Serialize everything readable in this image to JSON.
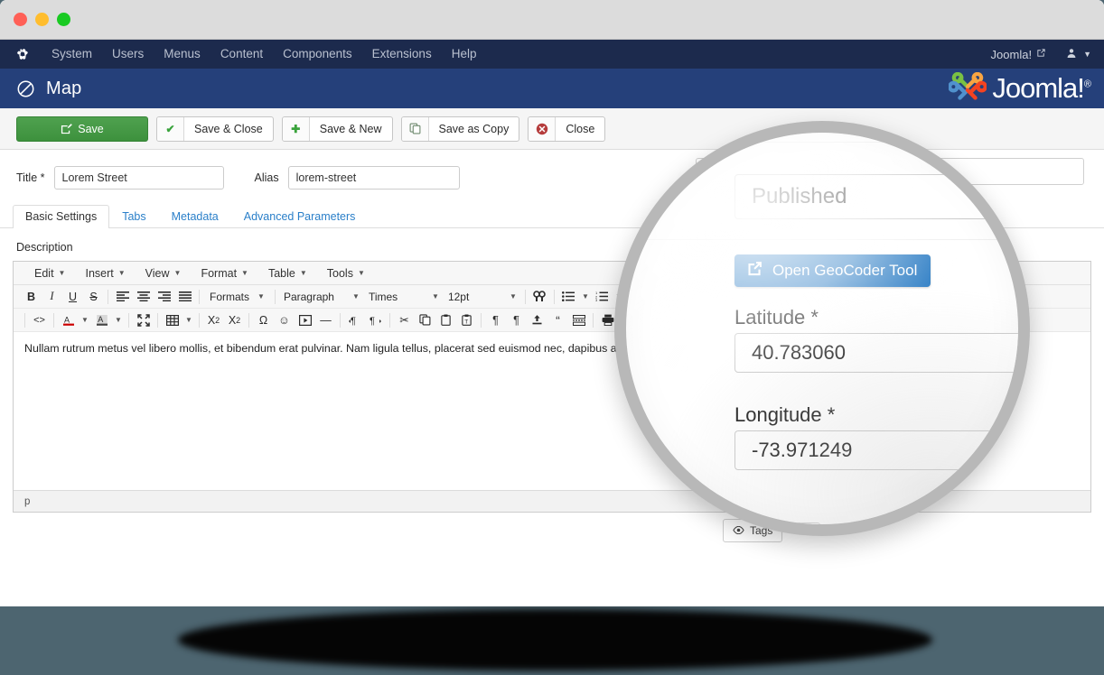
{
  "window": {
    "traffic_lights": [
      "close",
      "minimize",
      "maximize"
    ]
  },
  "admin_menu": {
    "brand_icon": "joomla-brand-icon",
    "items": [
      "System",
      "Users",
      "Menus",
      "Content",
      "Components",
      "Extensions",
      "Help"
    ],
    "site_link": "Joomla!",
    "external_link_icon": "external-link-icon",
    "user_icon": "user-icon",
    "caret_icon": "chevron-down-icon"
  },
  "subhead": {
    "page_icon": "map-marker-slash-icon",
    "title": "Map",
    "logo_text": "Joomla!",
    "logo_sup": "®"
  },
  "toolbar": {
    "buttons": [
      {
        "label": "Save",
        "icon": "pencil-square-icon",
        "style": "primary"
      },
      {
        "label": "Save & Close",
        "icon": "check-icon",
        "style": "default"
      },
      {
        "label": "Save & New",
        "icon": "plus-icon",
        "style": "default"
      },
      {
        "label": "Save as Copy",
        "icon": "copy-icon",
        "style": "default"
      },
      {
        "label": "Close",
        "icon": "cancel-circle-icon",
        "style": "default"
      }
    ]
  },
  "form": {
    "title_label": "Title *",
    "title_value": "Lorem Street",
    "alias_label": "Alias",
    "alias_value": "lorem-street",
    "tabs": [
      {
        "label": "Basic Settings",
        "active": true
      },
      {
        "label": "Tabs",
        "active": false
      },
      {
        "label": "Metadata",
        "active": false
      },
      {
        "label": "Advanced Parameters",
        "active": false
      }
    ],
    "description_label": "Description"
  },
  "editor": {
    "menubar": [
      "Edit",
      "Insert",
      "View",
      "Format",
      "Table",
      "Tools"
    ],
    "toolbar_row1": [
      {
        "name": "bold",
        "glyph": "B"
      },
      {
        "name": "italic",
        "glyph": "I"
      },
      {
        "name": "underline",
        "glyph": "U"
      },
      {
        "name": "strikethrough",
        "glyph": "S"
      },
      {
        "name": "align-left",
        "glyph": "☰"
      },
      {
        "name": "align-center",
        "glyph": "☰"
      },
      {
        "name": "align-right",
        "glyph": "☰"
      },
      {
        "name": "align-justify",
        "glyph": "☰"
      }
    ],
    "formats_label": "Formats",
    "paragraph_label": "Paragraph",
    "font_label": "Times",
    "fontsize_label": "12pt",
    "toolbar_row1_tail": [
      {
        "name": "search-replace",
        "glyph": "🔍"
      },
      {
        "name": "bullet-list",
        "glyph": "☰"
      },
      {
        "name": "numbered-list",
        "glyph": "☰"
      },
      {
        "name": "outdent",
        "glyph": "☰"
      }
    ],
    "toolbar_row2": [
      {
        "name": "source-code",
        "glyph": "<>"
      },
      {
        "name": "text-color",
        "glyph": "A"
      },
      {
        "name": "background-color",
        "glyph": "A"
      },
      {
        "name": "fullscreen",
        "glyph": "⛶"
      },
      {
        "name": "table",
        "glyph": "▦"
      },
      {
        "name": "subscript",
        "glyph": "X"
      },
      {
        "name": "superscript",
        "glyph": "X"
      },
      {
        "name": "special-character",
        "glyph": "Ω"
      },
      {
        "name": "emoticon",
        "glyph": "☺"
      },
      {
        "name": "media",
        "glyph": "▣"
      },
      {
        "name": "horizontal-rule",
        "glyph": "—"
      },
      {
        "name": "ltr",
        "glyph": "¶"
      },
      {
        "name": "rtl",
        "glyph": "¶"
      },
      {
        "name": "cut",
        "glyph": "✂"
      },
      {
        "name": "copy",
        "glyph": "❐"
      },
      {
        "name": "paste",
        "glyph": "Ὄb"
      },
      {
        "name": "paste-as-text",
        "glyph": "Ὄb"
      },
      {
        "name": "show-blocks",
        "glyph": "¶"
      },
      {
        "name": "visual-chars",
        "glyph": "¶"
      },
      {
        "name": "insert-file",
        "glyph": "⤒"
      },
      {
        "name": "blockquote",
        "glyph": "“"
      },
      {
        "name": "page-break",
        "glyph": "┅"
      },
      {
        "name": "print",
        "glyph": "⎙"
      }
    ],
    "body_text": "Nullam rutrum metus vel libero mollis, et bibendum erat pulvinar. Nam ligula tellus, placerat sed euismod nec, dapibus ac purus. Vestibulum metus ultricies condimentum ex.",
    "status_path": "p"
  },
  "right_column": {
    "status_value": "Published",
    "geocoder_button": "Open GeoCoder Tool",
    "geocoder_icon": "external-link-icon",
    "latitude_label": "Latitude *",
    "latitude_value": "40.783060",
    "longitude_label": "Longitude *",
    "longitude_value": "-73.971249",
    "tags_label": "Tags",
    "tags_icon": "eye-icon"
  },
  "colors": {
    "page_background": "#4d6570",
    "admin_menu": "#1c2a4d",
    "subhead": "#25407a",
    "primary_button": "#3d913d",
    "accent_blue": "#2b7cc4",
    "tab_link": "#2a7fc9"
  }
}
